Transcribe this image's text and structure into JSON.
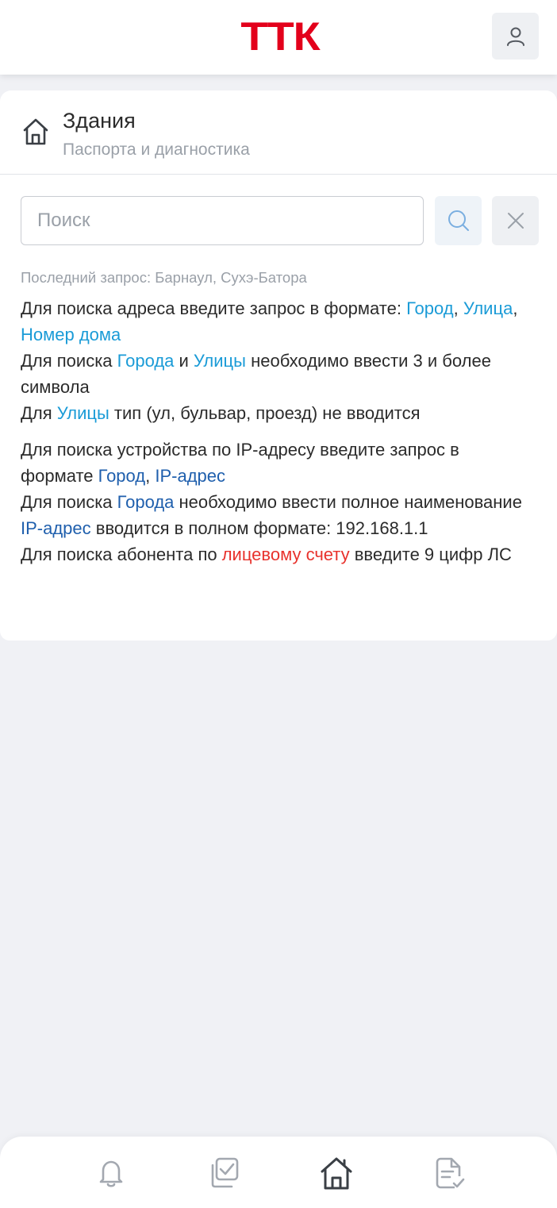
{
  "header": {
    "logo_text": "ТТК",
    "profile_icon": "user-icon"
  },
  "page": {
    "title": "Здания",
    "subtitle": "Паспорта и диагностика",
    "icon": "home-icon"
  },
  "search": {
    "placeholder": "Поиск",
    "value": "",
    "search_icon": "search-icon",
    "clear_icon": "close-icon",
    "last_query": "Последний запрос: Барнаул, Сухэ-Батора"
  },
  "hints": {
    "h1_a": "Для поиска адреса введите запрос в формате: ",
    "h1_city": "Город",
    "h1_sep1": ", ",
    "h1_street": "Улица",
    "h1_sep2": ", ",
    "h1_house": "Номер дома",
    "h2_a": "Для поиска ",
    "h2_city": "Города",
    "h2_and": " и ",
    "h2_street": "Улицы",
    "h2_b": " необходимо ввести 3 и более символа",
    "h3_a": "Для ",
    "h3_street": "Улицы",
    "h3_b": " тип (ул, бульвар, проезд) не вводится",
    "h4_a": "Для поиска устройства по IP-адресу введите запрос в формате ",
    "h4_city": "Город",
    "h4_sep": ", ",
    "h4_ip": "IP-адрес",
    "h5_a": "Для поиска ",
    "h5_city": "Города",
    "h5_b": " необходимо ввести полное наименование",
    "h6_ip": "IP-адрес",
    "h6_b": " вводится в полном формате: 192.168.1.1",
    "h7_a": "Для поиска абонента по ",
    "h7_account": "лицевому счету",
    "h7_b": " введите 9 цифр ЛС"
  },
  "bottom_nav": {
    "items": [
      {
        "icon": "bell-icon",
        "active": false
      },
      {
        "icon": "tasks-icon",
        "active": false
      },
      {
        "icon": "home-icon",
        "active": true
      },
      {
        "icon": "document-check-icon",
        "active": false
      }
    ]
  },
  "colors": {
    "brand_red": "#e3001b",
    "link_cyan": "#1a9bd7",
    "link_blue": "#1f5fad",
    "account_red": "#e8322c",
    "background": "#f0f1f5"
  }
}
